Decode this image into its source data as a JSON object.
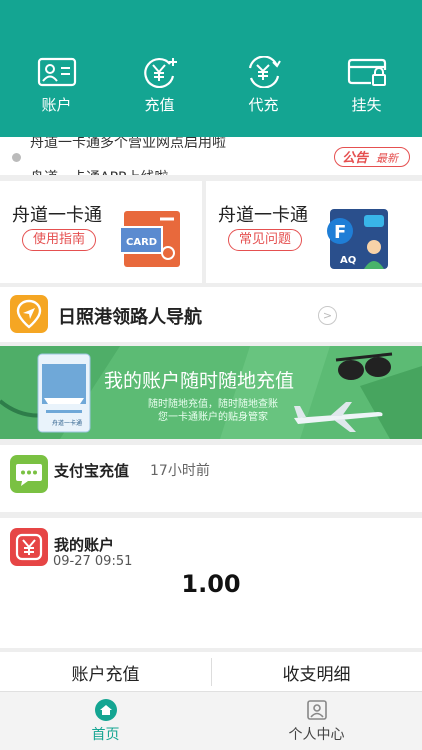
{
  "header": {
    "nav": [
      {
        "label": "账户",
        "icon": "id-card-icon"
      },
      {
        "label": "充值",
        "icon": "yen-add-icon"
      },
      {
        "label": "代充",
        "icon": "yen-exchange-icon"
      },
      {
        "label": "挂失",
        "icon": "locked-card-icon"
      }
    ]
  },
  "notice": {
    "line1": "舟道一卡通多个营业网点启用啦",
    "line2": "舟道一卡通APP上线啦",
    "badge_main": "公告",
    "badge_sub": "最新"
  },
  "cards": [
    {
      "title": "舟道一卡通",
      "button": "使用指南",
      "icon": "card-terminal-icon"
    },
    {
      "title": "舟道一卡通",
      "button": "常见问题",
      "icon": "faq-icon"
    }
  ],
  "guide": {
    "label": "日照港领路人导航",
    "icon": "location-icon"
  },
  "banner": {
    "title": "我的账户随时随地充值",
    "sub1": "随时随地充值，随时随地查账",
    "sub2": "您一卡通账户的贴身管家",
    "card_caption": "舟道一卡通"
  },
  "alipay": {
    "label": "支付宝充值",
    "time": "17小时前"
  },
  "account": {
    "title": "我的账户",
    "date": "09-27 09:51",
    "amount": "1.00"
  },
  "actions": {
    "recharge": "账户充值",
    "details": "收支明细"
  },
  "tabbar": [
    {
      "label": "首页",
      "active": true
    },
    {
      "label": "个人中心",
      "active": false
    }
  ],
  "colors": {
    "primary": "#14a592",
    "accent_red": "#e55050",
    "alipay_green": "#7ac142"
  }
}
